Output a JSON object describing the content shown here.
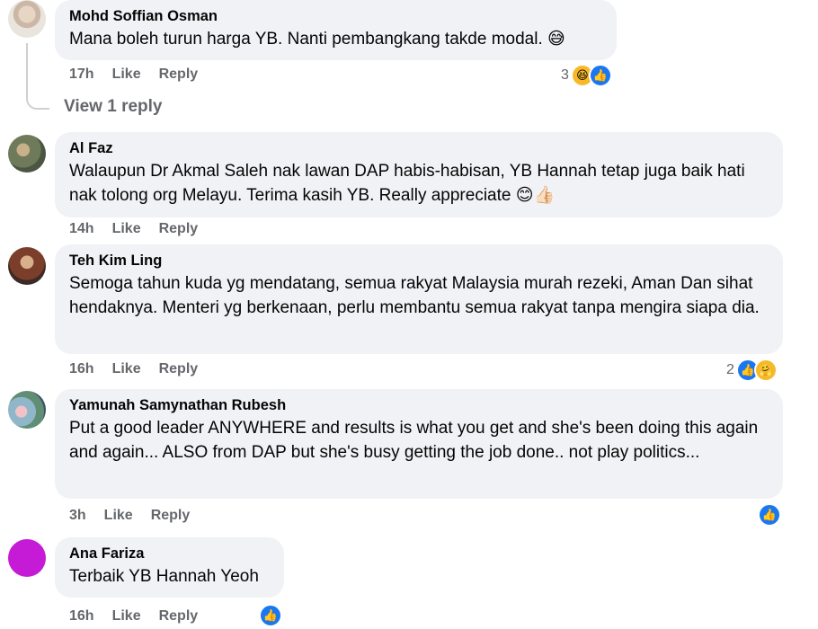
{
  "comments": [
    {
      "name": "Mohd Soffian Osman",
      "text": "Mana boleh turun harga YB. Nanti pembangkang takde modal. 😅",
      "time": "17h",
      "like": "Like",
      "reply": "Reply",
      "reaction_count": "3"
    },
    {
      "name": "Al Faz",
      "text": "Walaupun Dr Akmal Saleh nak lawan DAP habis-habisan, YB Hannah tetap juga baik hati nak tolong org Melayu. Terima kasih YB. Really appreciate 😊👍🏻",
      "time": "14h",
      "like": "Like",
      "reply": "Reply"
    },
    {
      "name": "Teh Kim Ling",
      "text": "Semoga tahun kuda yg mendatang, semua rakyat Malaysia murah rezeki, Aman Dan sihat hendaknya. Menteri yg berkenaan, perlu membantu semua rakyat tanpa mengira siapa dia.",
      "time": "16h",
      "like": "Like",
      "reply": "Reply",
      "reaction_count": "2"
    },
    {
      "name": "Yamunah Samynathan Rubesh",
      "text": "Put a good leader ANYWHERE and results is what you get and she's been doing this again and again... ALSO from DAP but she's busy getting the job done.. not play politics...",
      "time": "3h",
      "like": "Like",
      "reply": "Reply"
    },
    {
      "name": "Ana Fariza",
      "text": "Terbaik YB Hannah Yeoh",
      "time": "16h",
      "like": "Like",
      "reply": "Reply"
    }
  ],
  "view_reply": "View 1 reply",
  "icons": {
    "like": "like-reaction-icon",
    "haha": "haha-reaction-icon",
    "care": "care-reaction-icon"
  },
  "colors": {
    "bubble": "#f0f2f5",
    "meta_text": "#65676b",
    "like_blue": "#1877f2"
  }
}
